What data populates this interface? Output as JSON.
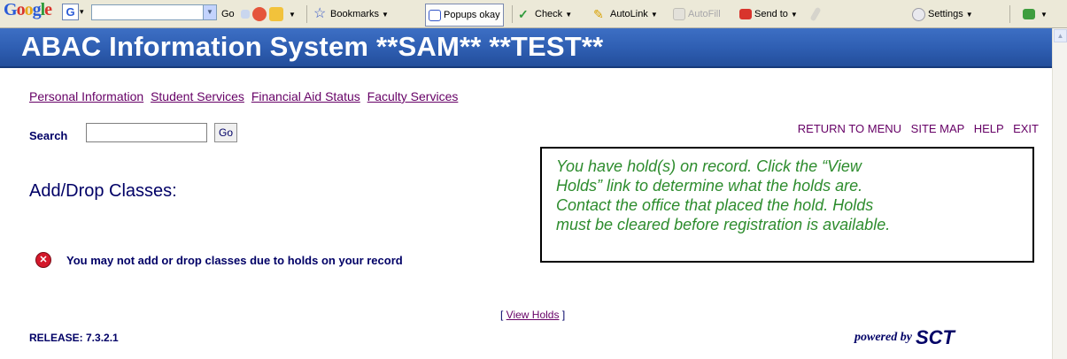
{
  "toolbar": {
    "google_logo": "Google",
    "google_g": "G",
    "go_label": "Go",
    "bookmarks_label": "Bookmarks",
    "popups_label": "Popups okay",
    "check_label": "Check",
    "autolink_label": "AutoLink",
    "autofill_label": "AutoFill",
    "sendto_label": "Send to",
    "settings_label": "Settings"
  },
  "banner": {
    "title": "ABAC Information System **SAM** **TEST**"
  },
  "nav": {
    "items": [
      {
        "label": "Personal Information"
      },
      {
        "label": "Student Services"
      },
      {
        "label": "Financial Aid Status"
      },
      {
        "label": "Faculty Services"
      }
    ]
  },
  "search": {
    "label": "Search",
    "value": "",
    "go_label": "Go"
  },
  "right_menu": {
    "return": "RETURN TO MENU",
    "sitemap": "SITE MAP",
    "help": "HELP",
    "exit": "EXIT"
  },
  "page": {
    "heading": "Add/Drop Classes:"
  },
  "error": {
    "icon": "error-x-icon",
    "message": "You may not add or drop classes due to holds on your record"
  },
  "callout": {
    "lines": [
      "You have hold(s) on record.  Click the “View",
      "Holds” link to determine what the holds are.",
      "Contact the office that placed the hold.  Holds",
      "must be cleared before registration is available."
    ]
  },
  "footer": {
    "view_holds_open": "[ ",
    "view_holds": "View Holds",
    "view_holds_close": " ]",
    "release": "RELEASE: 7.3.2.1",
    "powered_by": "powered by",
    "sct": "SCT"
  },
  "colors": {
    "banner": "#2f5fb3",
    "link": "#660066",
    "text": "#000066",
    "callout_text": "#2d8c2d",
    "error": "#d4182b"
  }
}
